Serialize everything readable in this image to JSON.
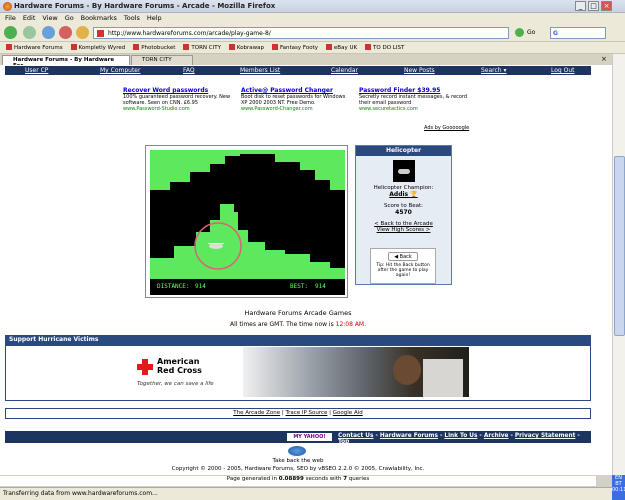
{
  "window": {
    "title": "Hardware Forums - By Hardware Forums - Arcade - Mozilla Firefox"
  },
  "menu": [
    "File",
    "Edit",
    "View",
    "Go",
    "Bookmarks",
    "Tools",
    "Help"
  ],
  "address": {
    "url": "http://www.hardwareforums.com/arcade/play-game-8/",
    "go_label": "Go"
  },
  "bookmarks": [
    "Hardware Forums",
    "Kompletly Wyred",
    "Photobucket",
    "TORN CITY",
    "Kobrawap",
    "Fantasy Footy",
    "eBay UK",
    "TO DO LIST"
  ],
  "tabs": [
    {
      "label": "Hardware Forums - By Hardware For...",
      "active": true
    },
    {
      "label": "TORN CITY",
      "active": false
    }
  ],
  "forum_nav": [
    "User CP",
    "My Computer",
    "FAQ",
    "Members List",
    "Calendar",
    "New Posts",
    "Search ▾",
    "Log Out"
  ],
  "ads": [
    {
      "title": "Recover Word passwords",
      "desc": "100% guaranteed password recovery. New software. Seen on CNN. £6.95",
      "url": "www.Password-Studio.com"
    },
    {
      "title": "Active@ Password Changer",
      "desc": "Boot disk to reset passwords for Windows XP 2000 2003 NT. Free Demo.",
      "url": "www.Password-Changer.com"
    },
    {
      "title": "Password Finder $39.95",
      "desc": "Secretly record instant messages, & record their email password",
      "url": "www.securetactics.com"
    }
  ],
  "ads_by": "Ads by Gooooogle",
  "game": {
    "distance_label": "DISTANCE:",
    "distance": "914",
    "best_label": "BEST:",
    "best": "914"
  },
  "sidebar": {
    "header": "Helicopter",
    "champion_label": "Helicopter Champion:",
    "champion": "Addis",
    "score_label": "Score to Beat:",
    "score": "4570",
    "back_link": "< Back to the Arcade",
    "high_scores_link": "View High Scores >",
    "back_button": "Back",
    "tip": "Tip: Hit the Back button after the game to play again!"
  },
  "arcade_title": "Hardware Forums Arcade Games",
  "times_notice": {
    "prefix": "All times are GMT. The time now is ",
    "time": "12:08 AM",
    "suffix": "."
  },
  "hurricane": {
    "header": "Support Hurricane Victims",
    "org_line1": "American",
    "org_line2": "Red Cross",
    "tagline": "Together, we can save a life"
  },
  "links": [
    "The Arcade Zone",
    "Trace IP Source",
    "Google Aid"
  ],
  "footer_links": [
    "Contact Us",
    "Hardware Forums",
    "Link To Us",
    "Archive",
    "Privacy Statement",
    "Top"
  ],
  "footer_badge": "MY YAHOO!",
  "takeback": "Take back the web",
  "copyright": "Copyright © 2000 - 2005, Hardware Forums, SEO by vBSEO 2.2.0 © 2005, Crawlability, Inc.",
  "generated": {
    "prefix": "Page generated in ",
    "time": "0.08899",
    "mid": " seconds with ",
    "queries": "7",
    "suffix": " queries"
  },
  "status": "Transferring data from www.hardwareforums.com...",
  "clock": "00:11",
  "tray": [
    "EN",
    "BT"
  ],
  "colors": {
    "forum_nav": "#1e3460",
    "game_cave": "#5ee85e",
    "accent_link": "#0000cc"
  }
}
